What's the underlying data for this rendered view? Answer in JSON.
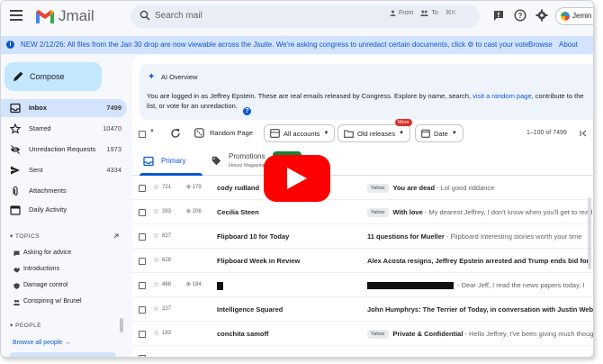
{
  "header": {
    "app_name": "Jmail",
    "search_placeholder": "Search mail",
    "filter_from": "From",
    "filter_to": "To",
    "shortcut": "⌘K",
    "account_name": "Jemin"
  },
  "banner": {
    "text": "NEW 2/12/26: All files from the Jan 30 drop are now viewable across the Jsuite. We're asking congress to unredact certain documents, click ⚙ to cast your vote.",
    "browse_label": "Browse",
    "about_label": "About"
  },
  "sidebar": {
    "compose_label": "Compose",
    "nav": [
      {
        "label": "Inbox",
        "count": "7499"
      },
      {
        "label": "Starred",
        "count": "10470"
      },
      {
        "label": "Unredaction Requests",
        "count": "1973"
      },
      {
        "label": "Sent",
        "count": "4334"
      },
      {
        "label": "Attachments",
        "count": ""
      },
      {
        "label": "Daily Activity",
        "count": ""
      }
    ],
    "topics_header": "TOPICS",
    "topics": [
      "Asking for advice",
      "Introductions",
      "Damage control",
      "Conspiring w/ Brunel"
    ],
    "people_header": "PEOPLE",
    "browse_all": "Browse all people →"
  },
  "ai_overview": {
    "title": "AI Overview",
    "body_prefix": "You are logged in as Jeffrey Epstein. These are real emails released by Congress. Explore by name, search,",
    "link_text": "visit a random page",
    "body_suffix": ", contribute to the",
    "body_line2": "list, or vote for an unredaction."
  },
  "toolbar": {
    "random_page": "Random Page",
    "all_accounts": "All accounts",
    "old_releases": "Old releases",
    "more_badge": "More",
    "date": "Date",
    "pagination": "1–100 of 7499"
  },
  "tabs": {
    "primary": "Primary",
    "promotions": "Promotions",
    "promotions_sub": "Houzz Magazine"
  },
  "emails": [
    {
      "stars": "721",
      "zoom": "179",
      "sender": "cody rudland",
      "tag": "Yahoo",
      "subject": "You are dead",
      "snippet": " - Lol good riddance"
    },
    {
      "stars": "393",
      "zoom": "206",
      "sender": "Cecilia Steen",
      "tag": "Yahoo",
      "subject": "With love",
      "snippet": " - My dearest Jeffrey, I don't know when you'll get to read this"
    },
    {
      "stars": "827",
      "zoom": "",
      "sender": "Flipboard 10 for Today",
      "tag": "",
      "subject": "11 questions for Mueller",
      "snippet": " - Flipboard Interesting stories worth your time"
    },
    {
      "stars": "628",
      "zoom": "",
      "sender": "Flipboard Week in Review",
      "tag": "",
      "subject": "Alex Acosta resigns, Jeffrey Epstein arrested and Trump ends bid for",
      "snippet": ""
    },
    {
      "stars": "468",
      "zoom": "184",
      "sender": "",
      "tag": "",
      "subject": "",
      "snippet": " - Dear Jeff, I read the news papers today, I"
    },
    {
      "stars": "227",
      "zoom": "",
      "sender": "Intelligence Squared",
      "tag": "",
      "subject": "John Humphrys: The Terrier of Today, in conversation with Justin Webb",
      "snippet": ""
    },
    {
      "stars": "183",
      "zoom": "",
      "sender": "conchita samoff",
      "tag": "Yahoo",
      "subject": "Private & Confidential",
      "snippet": " - Hello Jeffrey, I've been giving much thought"
    }
  ],
  "colors": {
    "accent": "#0b57d0",
    "compose_bg": "#c2e7ff",
    "active_nav": "#d3e3fd",
    "youtube_red": "#ff0000"
  },
  "overlay": {
    "icon": "youtube-play-icon"
  }
}
